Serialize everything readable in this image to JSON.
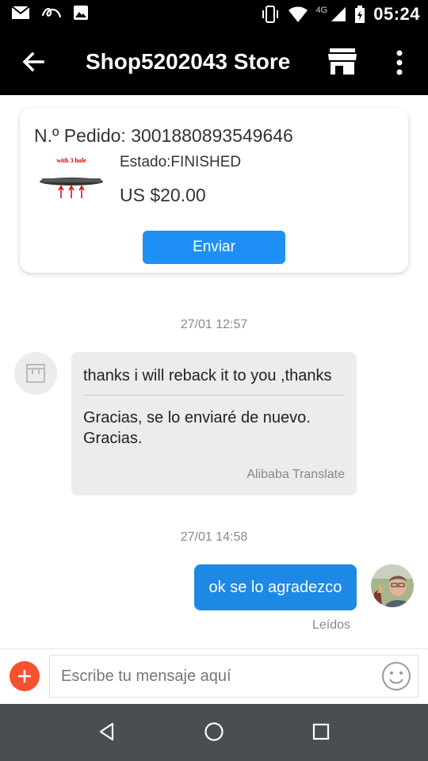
{
  "status_bar": {
    "clock": "05:24",
    "network": "4G",
    "icons": [
      "mail-icon",
      "aliexpress-icon",
      "gallery-icon",
      "vibrate-icon",
      "wifi-icon",
      "signal-icon",
      "battery-charging-icon"
    ]
  },
  "app_bar": {
    "title": "Shop5202043 Store",
    "icons": [
      "arrow-back-icon",
      "store-icon",
      "more-vert-icon"
    ]
  },
  "order": {
    "number_label": "N.º Pedido: 3001880893549646",
    "product_caption": "with 3 hole",
    "status": "Estado:FINISHED",
    "price": "US $20.00",
    "send_label": "Enviar"
  },
  "messages": {
    "time1": "27/01 12:57",
    "incoming": {
      "original": "thanks i will reback it to you ,thanks",
      "translation": "Gracias, se lo enviaré de nuevo. Gracias.",
      "provider": "Alibaba Translate"
    },
    "time2": "27/01 14:58",
    "outgoing": {
      "text": "ok se lo agradezco",
      "status": "Leídos"
    }
  },
  "composer": {
    "placeholder": "Escribe tu mensaje aquí",
    "icons": [
      "plus-icon",
      "emoji-icon"
    ]
  },
  "nav_bar": {
    "icons": [
      "nav-back-icon",
      "nav-home-icon",
      "nav-recents-icon"
    ]
  },
  "colors": {
    "accent": "#1e88e5",
    "plus": "#f5512f",
    "bar": "#000000",
    "nav": "#4a4d52"
  }
}
